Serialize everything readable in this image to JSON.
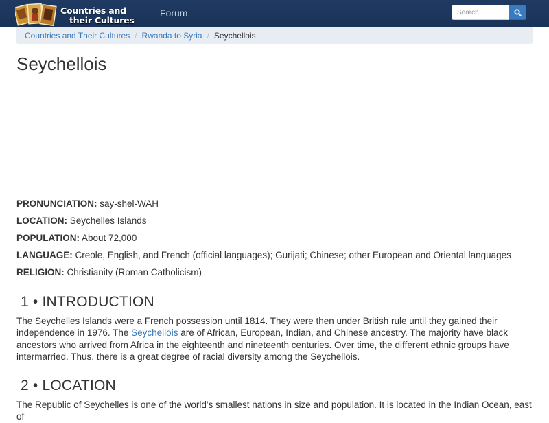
{
  "header": {
    "logo": {
      "line1": "Countries and",
      "line2": "their Cultures"
    },
    "nav_forum": "Forum",
    "search": {
      "placeholder": "Search...",
      "value": ""
    }
  },
  "breadcrumb": {
    "items": [
      "Countries and Their Cultures",
      "Rwanda to Syria"
    ],
    "current": "Seychellois"
  },
  "page_title": "Seychellois",
  "facts": [
    {
      "label": "PRONUNCIATION:",
      "value": " say-shel-WAH"
    },
    {
      "label": "LOCATION:",
      "value": " Seychelles Islands"
    },
    {
      "label": "POPULATION:",
      "value": " About 72,000"
    },
    {
      "label": "LANGUAGE:",
      "value": " Creole, English, and French (official languages); Gurijati; Chinese; other European and Oriental languages"
    },
    {
      "label": "RELIGION:",
      "value": " Christianity (Roman Catholicism)"
    }
  ],
  "sections": [
    {
      "heading": "1 • INTRODUCTION",
      "text_before_link": "The Seychelles Islands were a French possession until 1814. They were then under British rule until they gained their independence in 1976. The ",
      "link": "Seychellois",
      "text_after_link": " are of African, European, Indian, and Chinese ancestry. The majority have black ancestors who arrived from Africa in the eighteenth and nineteenth centuries. Over time, the different ethnic groups have intermarried. Thus, there is a great degree of racial diversity among the Seychellois."
    },
    {
      "heading": "2 • LOCATION",
      "text": "The Republic of Seychelles is one of the world's smallest nations in size and population. It is located in the Indian Ocean, east of"
    }
  ],
  "colors": {
    "navbar": "#1f3a63",
    "link": "#3a79b8",
    "search_button": "#3a7bbf",
    "breadcrumb_bg": "#e8edf3",
    "text": "#333333"
  },
  "icons": {
    "logo": "logo-collage-icon",
    "search": "search-icon"
  }
}
